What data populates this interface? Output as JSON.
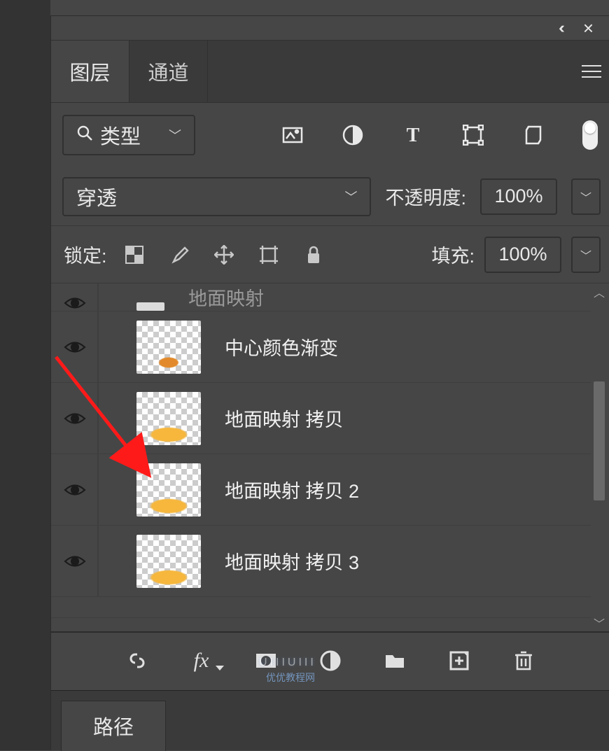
{
  "tabs": {
    "layers": "图层",
    "channels": "通道"
  },
  "filter": {
    "type_label": "类型"
  },
  "blend": {
    "mode": "穿透",
    "opacity_label": "不透明度:",
    "opacity_value": "100%"
  },
  "lock": {
    "label": "锁定:",
    "fill_label": "填充:",
    "fill_value": "100%"
  },
  "layers": {
    "partial_name": "地面映射",
    "items": [
      {
        "name": "中心颜色渐变"
      },
      {
        "name": "地面映射 拷贝"
      },
      {
        "name": "地面映射 拷贝 2"
      },
      {
        "name": "地面映射 拷贝 3"
      }
    ]
  },
  "paths_tab": "路径",
  "watermark": "UIIIUIII",
  "watermark_sub": "优优教程网"
}
